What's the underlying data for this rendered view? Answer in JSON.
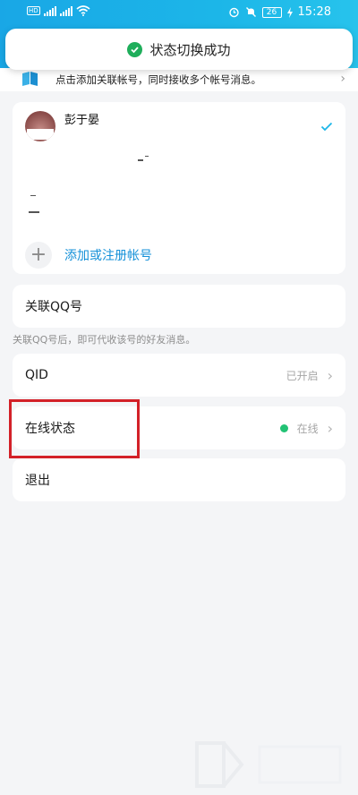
{
  "status_bar": {
    "time": "15:28",
    "battery": "26",
    "network_badge": "HD"
  },
  "toast": {
    "message": "状态切换成功"
  },
  "banner": {
    "text": "点击添加关联帐号，同时接收多个帐号消息。"
  },
  "account": {
    "name": "彭于晏",
    "add_label": "添加或注册帐号"
  },
  "linked_qq": {
    "label": "关联QQ号",
    "hint": "关联QQ号后，即可代收该号的好友消息。"
  },
  "qid": {
    "label": "QID",
    "value": "已开启"
  },
  "online_status": {
    "label": "在线状态",
    "value": "在线",
    "dot_color": "#22c274"
  },
  "logout": {
    "label": "退出"
  },
  "colors": {
    "brand_blue": "#1cb6e8",
    "link_blue": "#1490d8",
    "success_green": "#1fae5b",
    "highlight_red": "#d32128"
  },
  "icons": [
    "signal-icon",
    "wifi-icon",
    "alarm-icon",
    "mute-icon",
    "battery-icon",
    "success-check-icon",
    "book-icon",
    "chevron-right-icon",
    "checkmark-icon",
    "plus-icon"
  ]
}
